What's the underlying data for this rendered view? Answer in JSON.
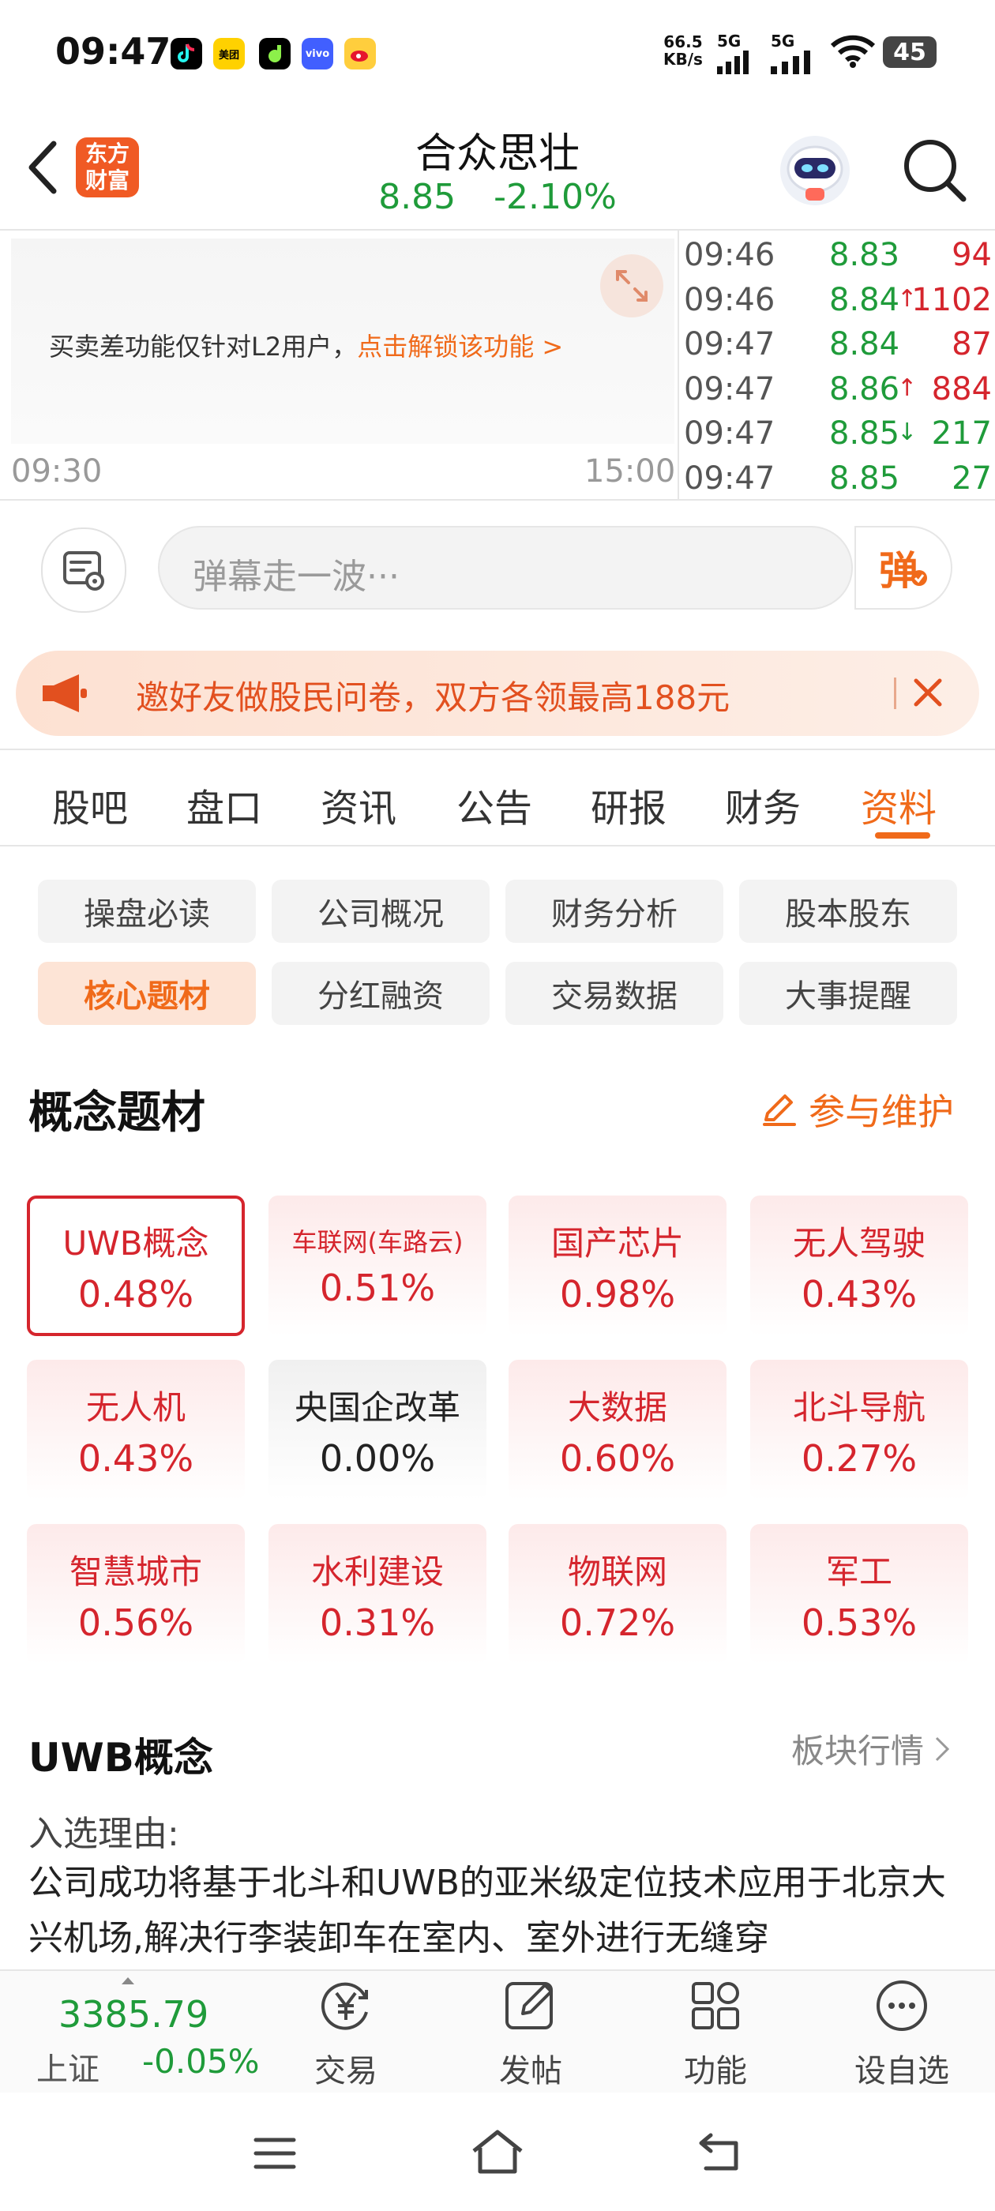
{
  "status_bar": {
    "time": "09:47",
    "app_icons": [
      {
        "name": "douyin-icon",
        "color": "#000000"
      },
      {
        "name": "meituan-icon",
        "label": "美团",
        "color": "#ffd100"
      },
      {
        "name": "game-icon",
        "color": "#000000"
      },
      {
        "name": "vivo-icon",
        "label": "vivo",
        "color": "#415fff"
      },
      {
        "name": "weibo-icon",
        "color": "#ffce3d"
      }
    ],
    "net_speed_value": "66.5",
    "net_speed_unit": "KB/s",
    "signal_1": "5G",
    "signal_2": "5G",
    "battery": "45"
  },
  "header": {
    "logo_line1": "东方",
    "logo_line2": "财富",
    "title": "合众思壮",
    "price": "8.85",
    "change": "-2.10%"
  },
  "chart": {
    "message": "买卖差功能仅针对L2用户，",
    "unlock_link": "点击解锁该功能 >",
    "time_start": "09:30",
    "time_end": "15:00"
  },
  "ticks": [
    {
      "time": "09:46",
      "price": "8.83",
      "arrow": "",
      "volume": "94",
      "price_color": "#1f9b3a",
      "vol_color": "#d5252d"
    },
    {
      "time": "09:46",
      "price": "8.84",
      "arrow": "↑",
      "volume": "1102",
      "price_color": "#1f9b3a",
      "vol_color": "#d5252d"
    },
    {
      "time": "09:47",
      "price": "8.84",
      "arrow": "",
      "volume": "87",
      "price_color": "#1f9b3a",
      "vol_color": "#d5252d"
    },
    {
      "time": "09:47",
      "price": "8.86",
      "arrow": "↑",
      "volume": "884",
      "price_color": "#1f9b3a",
      "vol_color": "#d5252d"
    },
    {
      "time": "09:47",
      "price": "8.85",
      "arrow": "↓",
      "volume": "217",
      "price_color": "#1f9b3a",
      "vol_color": "#1f9b3a"
    },
    {
      "time": "09:47",
      "price": "8.85",
      "arrow": "",
      "volume": "27",
      "price_color": "#1f9b3a",
      "vol_color": "#1f9b3a"
    }
  ],
  "danmaku": {
    "placeholder": "弹幕走一波···",
    "send_label": "弹"
  },
  "banner": {
    "text": "邀好友做股民问卷，双方各领最高188元"
  },
  "tabs": [
    "股吧",
    "盘口",
    "资讯",
    "公告",
    "研报",
    "财务",
    "资料"
  ],
  "active_tab": "资料",
  "sub_buttons": [
    "操盘必读",
    "公司概况",
    "财务分析",
    "股本股东",
    "核心题材",
    "分红融资",
    "交易数据",
    "大事提醒"
  ],
  "active_sub_button": "核心题材",
  "concepts_section": {
    "title": "概念题材",
    "maintain_label": "参与维护"
  },
  "concepts": [
    {
      "name": "UWB概念",
      "value": "0.48%"
    },
    {
      "name": "车联网(车路云)",
      "value": "0.51%"
    },
    {
      "name": "国产芯片",
      "value": "0.98%"
    },
    {
      "name": "无人驾驶",
      "value": "0.43%"
    },
    {
      "name": "无人机",
      "value": "0.43%"
    },
    {
      "name": "央国企改革",
      "value": "0.00%"
    },
    {
      "name": "大数据",
      "value": "0.60%"
    },
    {
      "name": "北斗导航",
      "value": "0.27%"
    },
    {
      "name": "智慧城市",
      "value": "0.56%"
    },
    {
      "name": "水利建设",
      "value": "0.31%"
    },
    {
      "name": "物联网",
      "value": "0.72%"
    },
    {
      "name": "军工",
      "value": "0.53%"
    }
  ],
  "detail": {
    "title": "UWB概念",
    "sector_link": "板块行情",
    "reason_label": "入选理由:",
    "reason_text": "公司成功将基于北斗和UWB的亚米级定位技术应用于北京大兴机场,解决行李装卸车在室内、室外进行无缝穿"
  },
  "bottom_bar": {
    "index_value": "3385.79",
    "index_name": "上证",
    "index_change": "-0.05%",
    "items": [
      "交易",
      "发帖",
      "功能",
      "设自选"
    ]
  },
  "colors": {
    "accent": "#f06a1a",
    "up_red": "#d5252d",
    "down_green": "#1f9b3a"
  }
}
